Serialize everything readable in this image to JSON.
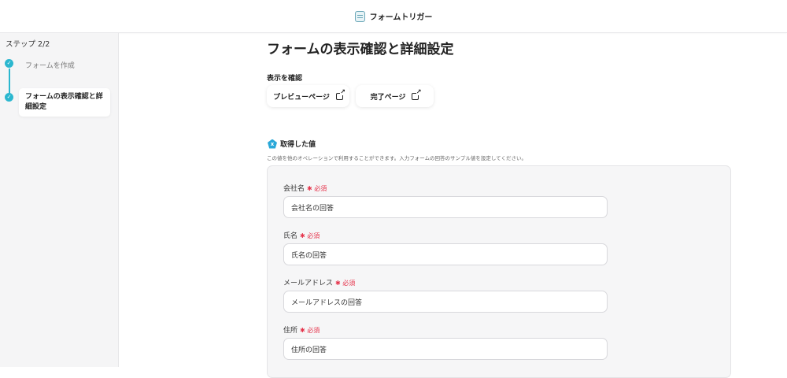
{
  "header": {
    "app_title": "フォームトリガー"
  },
  "sidebar": {
    "step_count": "ステップ 2/2",
    "steps": [
      {
        "label": "フォームを作成"
      },
      {
        "label": "フォームの表示確認と詳細設定"
      }
    ]
  },
  "main": {
    "title": "フォームの表示確認と詳細設定",
    "preview_heading": "表示を確認",
    "preview_button": "プレビューページ",
    "complete_button": "完了ページ",
    "section_title": "取得した値",
    "section_description": "この値を他のオペレーションで利用することができます。入力フォームの回答のサンプル値を設定してください。",
    "required_label": "必須",
    "fields": [
      {
        "label": "会社名",
        "value": "会社名の回答"
      },
      {
        "label": "氏名",
        "value": "氏名の回答"
      },
      {
        "label": "メールアドレス",
        "value": "メールアドレスの回答"
      },
      {
        "label": "住所",
        "value": "住所の回答"
      }
    ]
  }
}
